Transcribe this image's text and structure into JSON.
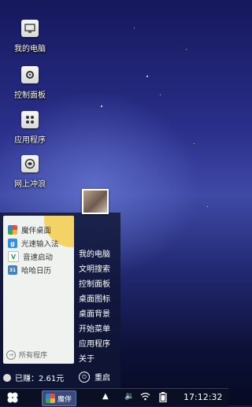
{
  "desktop": {
    "icons": [
      {
        "label": "我的电脑",
        "icon": "computer-icon"
      },
      {
        "label": "控制面板",
        "icon": "control-panel-icon"
      },
      {
        "label": "应用程序",
        "icon": "apps-icon"
      },
      {
        "label": "网上冲浪",
        "icon": "browser-icon"
      }
    ]
  },
  "start_menu": {
    "apps": [
      {
        "label": "魔伴桌面",
        "icon": "moban-icon",
        "color": "#e94b3c"
      },
      {
        "label": "光速输入法",
        "icon": "keyboard-icon",
        "color": "#2f8fe0"
      },
      {
        "label": "音速启动",
        "icon": "v-icon",
        "color": "#2aa54a"
      },
      {
        "label": "哈哈日历",
        "icon": "calendar-icon",
        "color": "#3b83c4"
      }
    ],
    "all_programs": "所有程序",
    "right_items": [
      "我的电脑",
      "文明搜索",
      "控制面板",
      "桌面图标",
      "桌面背景",
      "开始菜单",
      "应用程序",
      "关于"
    ],
    "balance": "已赚：2.61元",
    "restart": "重启"
  },
  "taskbar": {
    "task_label": "魔伴",
    "clock": "17:12:32"
  }
}
